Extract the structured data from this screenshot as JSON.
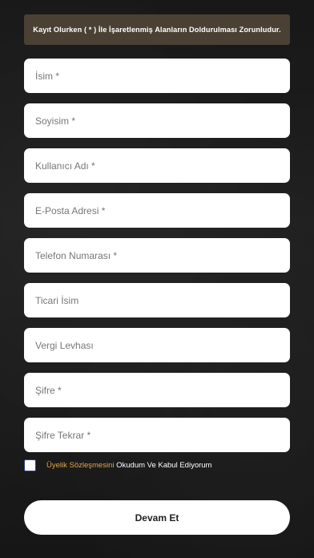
{
  "notice": "Kayıt Olurken ( * ) İle İşaretlenmiş Alanların Doldurulması Zorunludur.",
  "fields": [
    {
      "placeholder": "İsim *",
      "value": ""
    },
    {
      "placeholder": "Soyisim *",
      "value": ""
    },
    {
      "placeholder": "Kullanıcı Adı *",
      "value": ""
    },
    {
      "placeholder": "E-Posta Adresi *",
      "value": ""
    },
    {
      "placeholder": "Telefon Numarası *",
      "value": ""
    },
    {
      "placeholder": "Ticari İsim",
      "value": ""
    },
    {
      "placeholder": "Vergi Levhası",
      "value": ""
    },
    {
      "placeholder": "Şifre *",
      "value": ""
    },
    {
      "placeholder": "Şifre Tekrar *",
      "value": ""
    }
  ],
  "agreement": {
    "link_text": "Üyelik Sözleşmesini",
    "rest_text": " Okudum Ve Kabul Ediyorum",
    "checked": false
  },
  "submit_label": "Devam Et",
  "colors": {
    "accent": "#e7a443",
    "notice_bg": "#4a4134",
    "checkbox_border": "#2f3f8f"
  }
}
